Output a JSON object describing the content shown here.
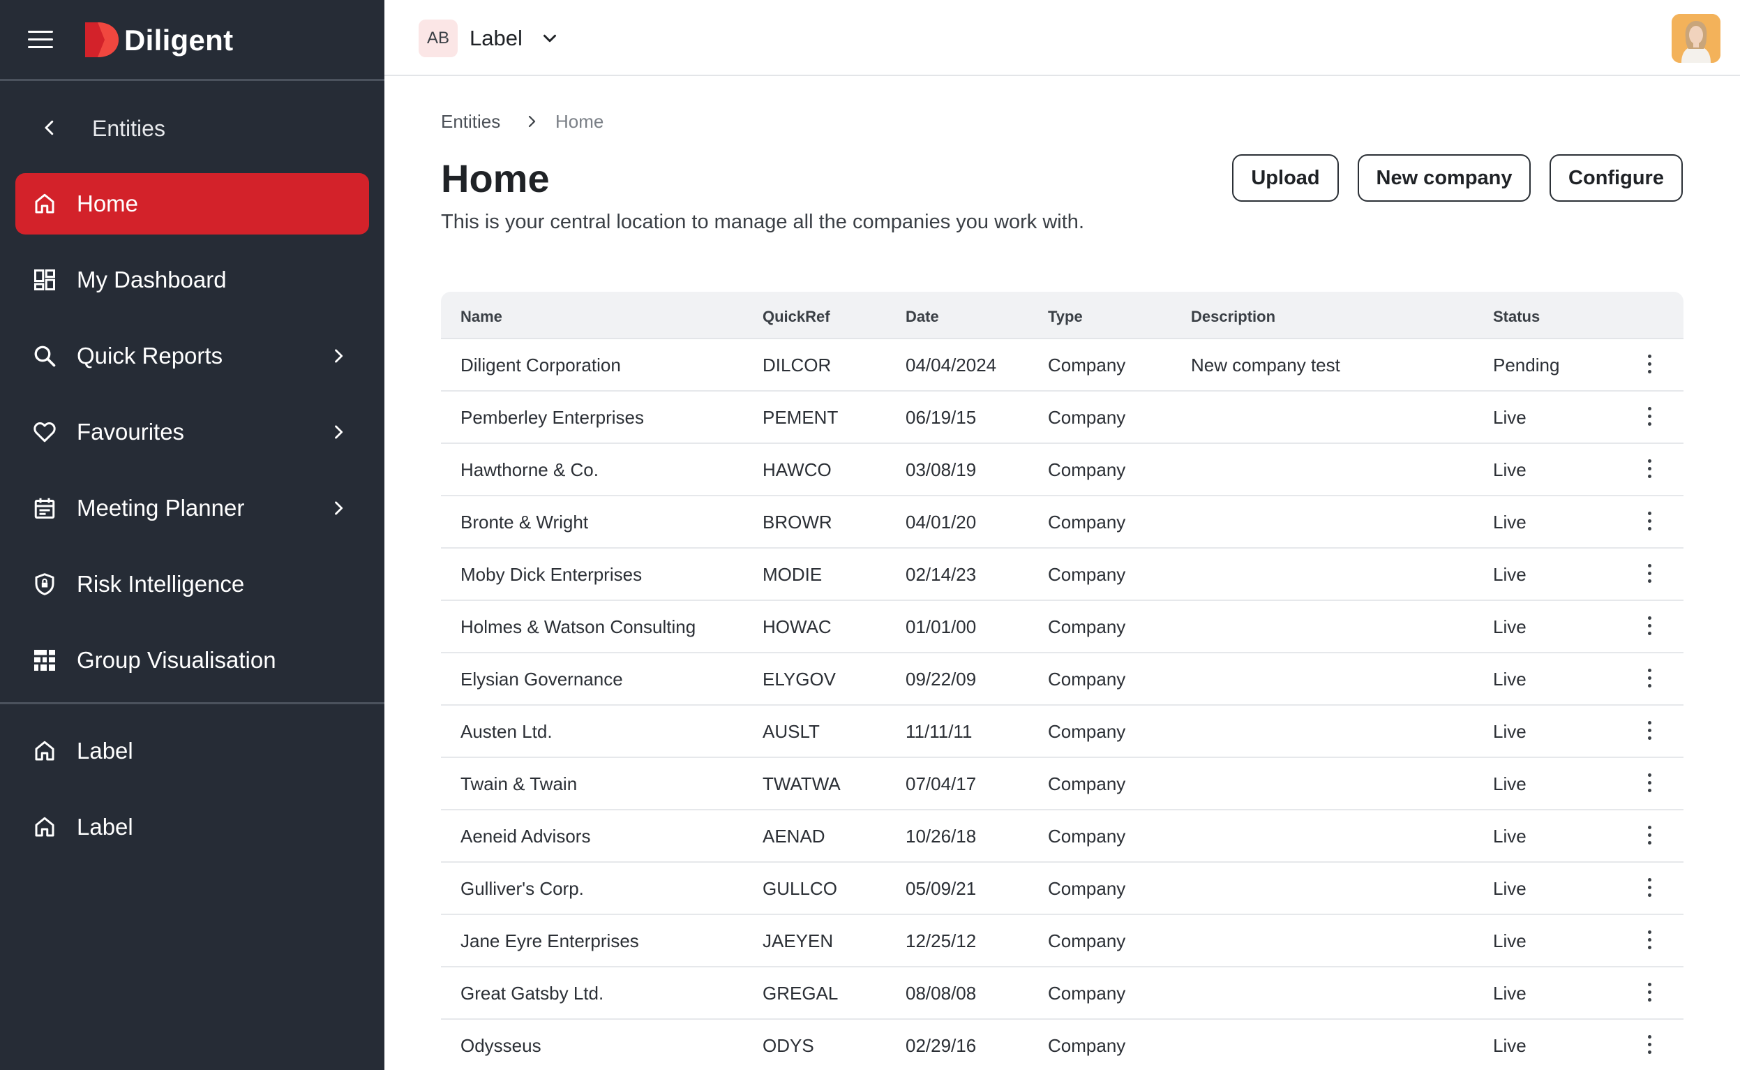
{
  "brand": {
    "name": "Diligent",
    "accent": "#d3222a",
    "sidebar_bg": "#262c36"
  },
  "sidebar": {
    "back_label": "Entities",
    "items": [
      {
        "label": "Home",
        "icon": "home-icon",
        "active": true,
        "has_arrow": false
      },
      {
        "label": "My Dashboard",
        "icon": "dashboard-icon",
        "active": false,
        "has_arrow": false
      },
      {
        "label": "Quick Reports",
        "icon": "search-icon",
        "active": false,
        "has_arrow": true
      },
      {
        "label": "Favourites",
        "icon": "heart-icon",
        "active": false,
        "has_arrow": true
      },
      {
        "label": "Meeting Planner",
        "icon": "calendar-icon",
        "active": false,
        "has_arrow": true
      },
      {
        "label": "Risk Intelligence",
        "icon": "shield-icon",
        "active": false,
        "has_arrow": false
      },
      {
        "label": "Group Visualisation",
        "icon": "grid-icon",
        "active": false,
        "has_arrow": false
      }
    ],
    "extra_items": [
      {
        "label": "Label",
        "icon": "home-icon"
      },
      {
        "label": "Label",
        "icon": "home-icon"
      }
    ]
  },
  "header": {
    "org_initials": "AB",
    "org_label": "Label"
  },
  "breadcrumb": {
    "parent": "Entities",
    "current": "Home"
  },
  "page": {
    "title": "Home",
    "subtitle": "This is your central location to manage all the companies you work with."
  },
  "actions": {
    "upload": "Upload",
    "new_company": "New company",
    "configure": "Configure"
  },
  "table": {
    "columns": {
      "name": "Name",
      "quickref": "QuickRef",
      "date": "Date",
      "type": "Type",
      "description": "Description",
      "status": "Status"
    },
    "rows": [
      {
        "name": "Diligent Corporation",
        "quickref": "DILCOR",
        "date": "04/04/2024",
        "type": "Company",
        "description": "New company test",
        "status": "Pending"
      },
      {
        "name": "Pemberley Enterprises",
        "quickref": "PEMENT",
        "date": "06/19/15",
        "type": "Company",
        "description": "",
        "status": "Live"
      },
      {
        "name": "Hawthorne & Co.",
        "quickref": "HAWCO",
        "date": "03/08/19",
        "type": "Company",
        "description": "",
        "status": "Live"
      },
      {
        "name": "Bronte & Wright",
        "quickref": "BROWR",
        "date": "04/01/20",
        "type": "Company",
        "description": "",
        "status": "Live"
      },
      {
        "name": "Moby Dick Enterprises",
        "quickref": "MODIE",
        "date": "02/14/23",
        "type": "Company",
        "description": "",
        "status": "Live"
      },
      {
        "name": "Holmes & Watson Consulting",
        "quickref": "HOWAC",
        "date": "01/01/00",
        "type": "Company",
        "description": "",
        "status": "Live"
      },
      {
        "name": "Elysian Governance",
        "quickref": "ELYGOV",
        "date": "09/22/09",
        "type": "Company",
        "description": "",
        "status": "Live"
      },
      {
        "name": "Austen Ltd.",
        "quickref": "AUSLT",
        "date": "11/11/11",
        "type": "Company",
        "description": "",
        "status": "Live"
      },
      {
        "name": "Twain & Twain",
        "quickref": "TWATWA",
        "date": "07/04/17",
        "type": "Company",
        "description": "",
        "status": "Live"
      },
      {
        "name": "Aeneid Advisors",
        "quickref": "AENAD",
        "date": "10/26/18",
        "type": "Company",
        "description": "",
        "status": "Live"
      },
      {
        "name": "Gulliver's Corp.",
        "quickref": "GULLCO",
        "date": "05/09/21",
        "type": "Company",
        "description": "",
        "status": "Live"
      },
      {
        "name": "Jane Eyre Enterprises",
        "quickref": "JAEYEN",
        "date": "12/25/12",
        "type": "Company",
        "description": "",
        "status": "Live"
      },
      {
        "name": "Great Gatsby Ltd.",
        "quickref": "GREGAL",
        "date": "08/08/08",
        "type": "Company",
        "description": "",
        "status": "Live"
      },
      {
        "name": "Odysseus",
        "quickref": "ODYS",
        "date": "02/29/16",
        "type": "Company",
        "description": "",
        "status": "Live"
      }
    ]
  }
}
